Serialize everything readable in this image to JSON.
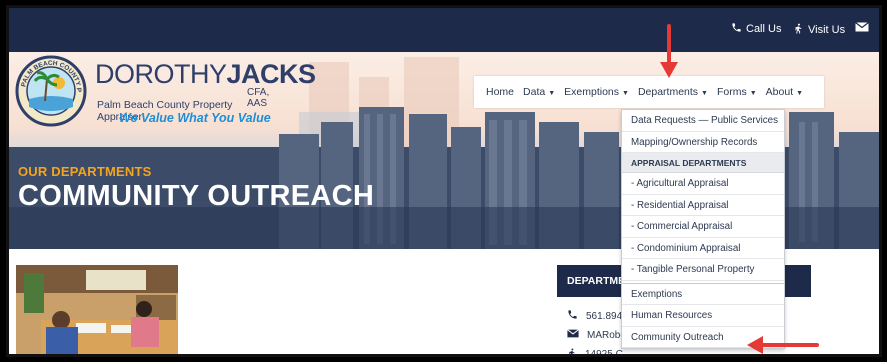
{
  "utility": {
    "call_label": "Call Us",
    "visit_label": "Visit Us"
  },
  "brand": {
    "name_light": "DOROTHY",
    "name_bold": "JACKS",
    "credentials": "CFA, AAS",
    "subtitle": "Palm Beach County Property Appraiser",
    "tagline": "We Value What You Value",
    "seal_text": "PALM BEACH COUNTY PROPERTY APPRAISER"
  },
  "nav": {
    "items": [
      {
        "label": "Home",
        "caret": false
      },
      {
        "label": "Data",
        "caret": true
      },
      {
        "label": "Exemptions",
        "caret": true
      },
      {
        "label": "Departments",
        "caret": true
      },
      {
        "label": "Forms",
        "caret": true
      },
      {
        "label": "About",
        "caret": true
      }
    ]
  },
  "hero": {
    "eyebrow": "OUR DEPARTMENTS",
    "title": "COMMUNITY OUTREACH"
  },
  "dropdown": {
    "item1": "Data Requests — Public Services",
    "item2": "Mapping/Ownership Records",
    "header": "APPRAISAL DEPARTMENTS",
    "item3": "- Agricultural Appraisal",
    "item4": "- Residential Appraisal",
    "item5": "- Commercial Appraisal",
    "item6": "- Condominium Appraisal",
    "item7": "- Tangible Personal Property",
    "item8": "Exemptions",
    "item9": "Human Resources",
    "item10": "Community Outreach"
  },
  "sidecard": {
    "title": "DEPARTME",
    "phone": "561.894",
    "email": "MARobe",
    "address": "14925 C"
  },
  "colors": {
    "navy": "#1d2a49",
    "accent_orange": "#f4a51d",
    "tagline_blue": "#1f8ed6",
    "annotation_red": "#e53935"
  }
}
